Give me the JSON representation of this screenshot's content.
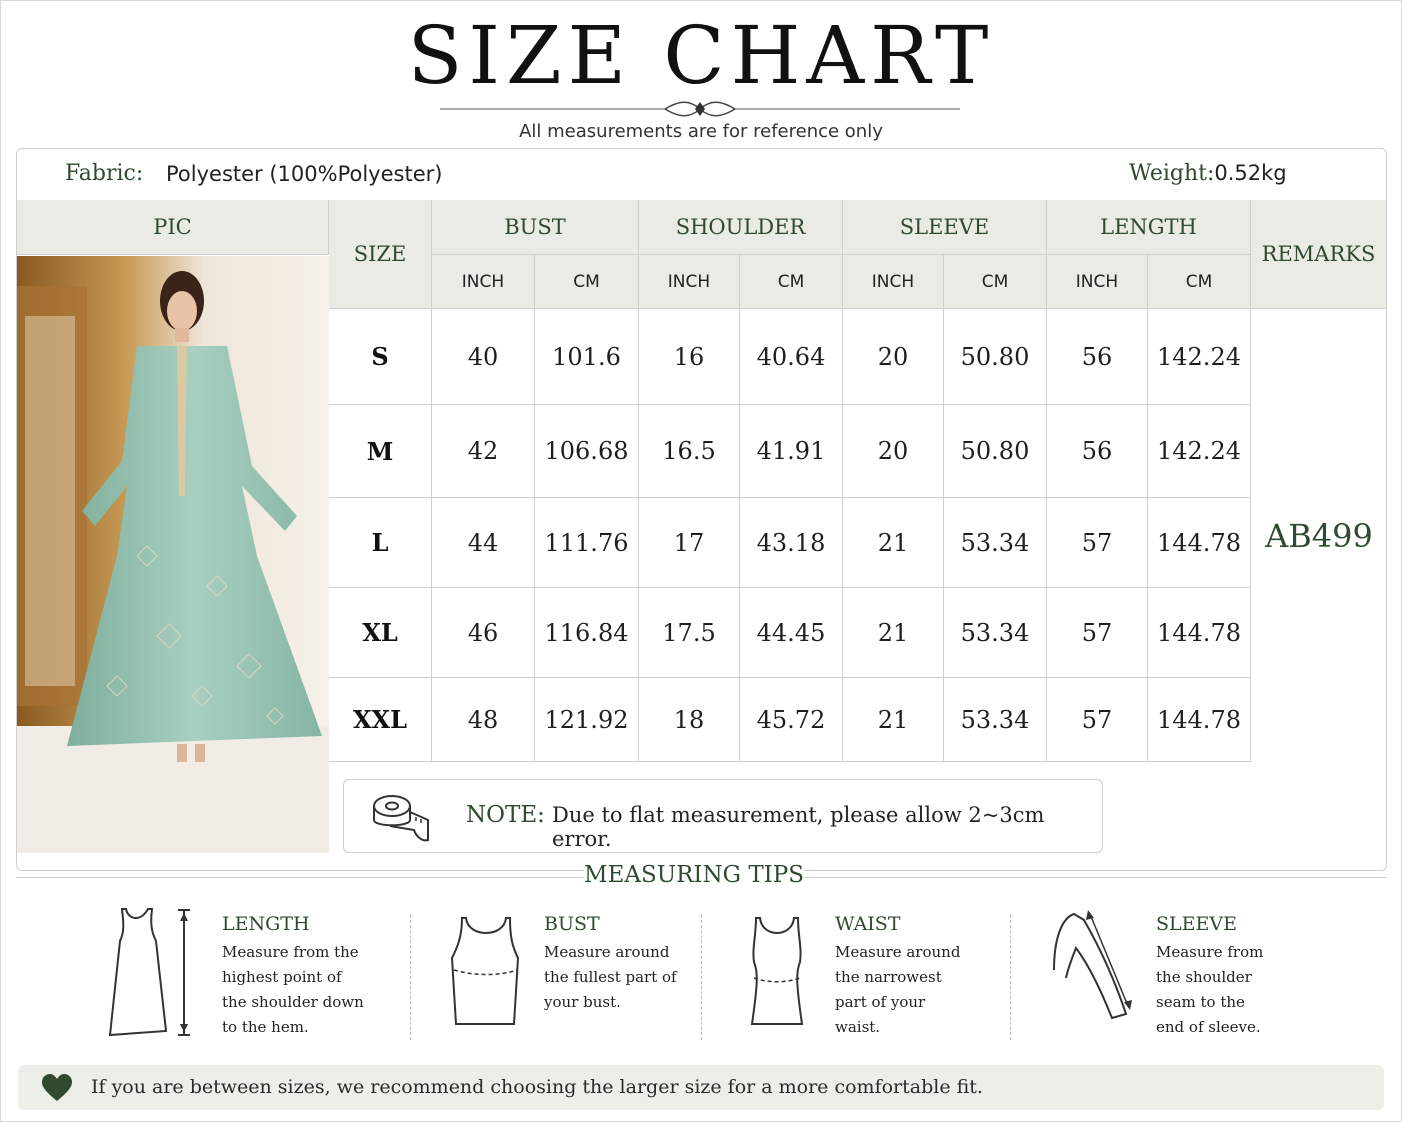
{
  "header": {
    "title": "SIZE CHART",
    "subtitle": "All measurements are for reference only"
  },
  "info": {
    "fabric_label": "Fabric:",
    "fabric_value": "Polyester (100%Polyester)",
    "weight_label": "Weight:",
    "weight_value": "0.52kg"
  },
  "table": {
    "pic_header": "PIC",
    "size_header": "SIZE",
    "groups": [
      "BUST",
      "SHOULDER",
      "SLEEVE",
      "LENGTH"
    ],
    "units": [
      "INCH",
      "CM",
      "INCH",
      "CM",
      "INCH",
      "CM",
      "INCH",
      "CM"
    ],
    "remarks_header": "REMARKS",
    "remarks_value": "AB499",
    "rows": [
      {
        "size": "S",
        "values": [
          "40",
          "101.6",
          "16",
          "40.64",
          "20",
          "50.80",
          "56",
          "142.24"
        ]
      },
      {
        "size": "M",
        "values": [
          "42",
          "106.68",
          "16.5",
          "41.91",
          "20",
          "50.80",
          "56",
          "142.24"
        ]
      },
      {
        "size": "L",
        "values": [
          "44",
          "111.76",
          "17",
          "43.18",
          "21",
          "53.34",
          "57",
          "144.78"
        ]
      },
      {
        "size": "XL",
        "values": [
          "46",
          "116.84",
          "17.5",
          "44.45",
          "21",
          "53.34",
          "57",
          "144.78"
        ]
      },
      {
        "size": "XXL",
        "values": [
          "48",
          "121.92",
          "18",
          "45.72",
          "21",
          "53.34",
          "57",
          "144.78"
        ]
      }
    ]
  },
  "note": {
    "label": "NOTE:",
    "text": "Due to flat measurement, please allow 2~3cm error.",
    "icon": "measuring-tape-icon"
  },
  "tips": {
    "title": "MEASURING TIPS",
    "items": [
      {
        "name": "LENGTH",
        "icon": "dress-length-icon",
        "lines": [
          "Measure from the",
          "highest point of",
          "the shoulder down",
          "to the hem."
        ]
      },
      {
        "name": "BUST",
        "icon": "tank-bust-icon",
        "lines": [
          "Measure around",
          "the fullest part of",
          "your bust."
        ]
      },
      {
        "name": "WAIST",
        "icon": "tank-waist-icon",
        "lines": [
          "Measure around",
          "the narrowest",
          "part of your",
          "waist."
        ]
      },
      {
        "name": "SLEEVE",
        "icon": "sleeve-icon",
        "lines": [
          "Measure from",
          "the shoulder",
          "seam to the",
          "end of sleeve."
        ]
      }
    ]
  },
  "footer": {
    "text": "If you are between sizes, we recommend choosing the larger size for a more comfortable fit.",
    "icon": "heart-icon"
  },
  "colors": {
    "accent_green": "#2f4a2f",
    "header_bg": "#e9ebe4",
    "border": "#d0d0d0"
  }
}
